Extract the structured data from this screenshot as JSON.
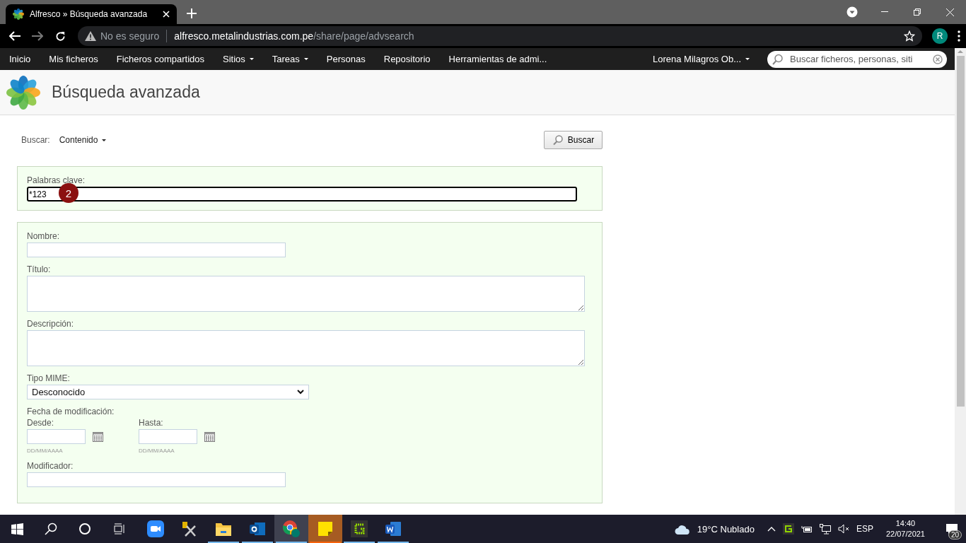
{
  "browser": {
    "tab_title": "Alfresco » Búsqueda avanzada",
    "security": "No es seguro",
    "url_host": "alfresco.metalindustrias.com.pe",
    "url_path": "/share/page/advsearch",
    "profile_initial": "R"
  },
  "nav": {
    "items": [
      {
        "label": "Inicio",
        "menu": false
      },
      {
        "label": "Mis ficheros",
        "menu": false
      },
      {
        "label": "Ficheros compartidos",
        "menu": false
      },
      {
        "label": "Sitios",
        "menu": true
      },
      {
        "label": "Tareas",
        "menu": true
      },
      {
        "label": "Personas",
        "menu": false
      },
      {
        "label": "Repositorio",
        "menu": false
      },
      {
        "label": "Herramientas de admi...",
        "menu": false
      }
    ],
    "user": "Lorena Milagros Ob...",
    "search_placeholder": "Buscar ficheros, personas, siti"
  },
  "page": {
    "title": "Búsqueda avanzada"
  },
  "search_for": {
    "label": "Buscar:",
    "value": "Contenido",
    "button": "Buscar"
  },
  "keywords": {
    "label": "Palabras clave:",
    "value": "*123",
    "marker": "2"
  },
  "fields": [
    {
      "kind": "text",
      "label": "Nombre:"
    },
    {
      "kind": "textarea",
      "label": "Título:"
    },
    {
      "kind": "textarea",
      "label": "Descripción:"
    },
    {
      "kind": "select",
      "label": "Tipo MIME:",
      "value": "Desconocido"
    },
    {
      "kind": "daterange",
      "label": "Fecha de modificación:",
      "from": {
        "label": "Desde:",
        "hint": "DD/MM/AAAA"
      },
      "to": {
        "label": "Hasta:",
        "hint": "DD/MM/AAAA"
      }
    },
    {
      "kind": "text",
      "label": "Modificador:"
    }
  ],
  "taskbar": {
    "apps": [
      {
        "kind": "zoom",
        "running": false,
        "selected": false,
        "attention": false
      },
      {
        "kind": "tools",
        "running": false,
        "selected": false,
        "attention": false
      },
      {
        "kind": "folder",
        "running": true,
        "selected": false,
        "attention": false
      },
      {
        "kind": "outlook",
        "running": true,
        "selected": false,
        "attention": false
      },
      {
        "kind": "chrome",
        "running": true,
        "selected": true,
        "attention": false
      },
      {
        "kind": "notes",
        "running": true,
        "selected": false,
        "attention": true
      },
      {
        "kind": "greenshot",
        "running": true,
        "selected": false,
        "attention": false
      },
      {
        "kind": "word",
        "running": true,
        "selected": false,
        "attention": false
      }
    ],
    "weather": "19°C  Nublado",
    "language": "ESP",
    "time": "14:40",
    "date": "22/07/2021",
    "notifications": "20"
  }
}
